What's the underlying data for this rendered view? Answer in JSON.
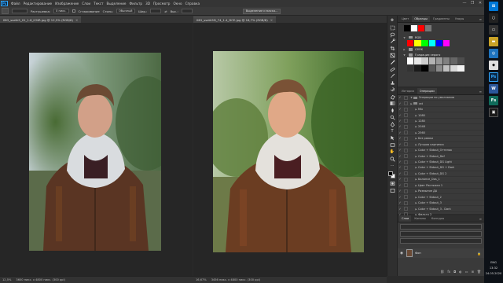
{
  "menubar": {
    "logo": "Ps",
    "items": [
      "Файл",
      "Редактирование",
      "Изображение",
      "Слои",
      "Текст",
      "Выделение",
      "Фильтр",
      "3D",
      "Просмотр",
      "Окно",
      "Справка"
    ],
    "controls": [
      "—",
      "❐",
      "✕"
    ]
  },
  "options": {
    "feather_label": "Растушевка:",
    "feather_value": "0 пикс.",
    "antialias_label": "Сглаживание",
    "style_label": "Стиль:",
    "style_value": "Обычный",
    "width_label": "Шир.:",
    "height_label": "Выс.:",
    "mask_button": "Выделение и маска..."
  },
  "tabs": {
    "doc1": "IMG_sseth5_01_1.8_ICNR.jpg @ 12,5% (RGB/8)",
    "doc2": "IMG_sseth5D_74_1.4_DCE.jpg @ 16,7% (RGB/8)",
    "close": "×"
  },
  "status": {
    "zoom1": "12,5%",
    "size1": "3600 пикс. x 4800 пикс. (300 ppi)",
    "zoom2": "16,67%",
    "size2": "3456 пикс. x 4800 пикс. (300 ppi)"
  },
  "tools": [
    "move",
    "marquee",
    "lasso",
    "quick-select",
    "crop",
    "frame",
    "eyedropper",
    "healing",
    "brush",
    "stamp",
    "history-brush",
    "eraser",
    "gradient",
    "blur",
    "dodge",
    "pen",
    "type",
    "path-select",
    "rectangle",
    "hand",
    "zoom",
    "more"
  ],
  "swatches_panel": {
    "tabs": [
      "Цвет",
      "Образцы",
      "Градиенты",
      "Узоры"
    ],
    "active_tab": "Образцы",
    "groups": [
      {
        "label": "RGB",
        "colors": [
          "#ff0000",
          "#ffff00",
          "#00ff00",
          "#00ffff",
          "#0000ff",
          "#ff00ff"
        ]
      },
      {
        "label": "CMYK",
        "colors": [
          "#00a0e9",
          "#e4007f",
          "#fff100",
          "#000000"
        ]
      },
      {
        "label": "Градации серого",
        "colors": [
          "#ffffff",
          "#e6e6e6",
          "#cccccc",
          "#b3b3b3",
          "#999999",
          "#808080",
          "#666666",
          "#4d4d4d",
          "#333333",
          "#1a1a1a",
          "#000000",
          "#595959",
          "#8c8c8c",
          "#bfbfbf",
          "#d9d9d9",
          "#f2f2f2"
        ]
      }
    ]
  },
  "actions_panel": {
    "tabs": [
      "История",
      "Операции"
    ],
    "active_tab": "Операции",
    "rows": [
      {
        "label": "Операции по умолчанию",
        "type": "folder"
      },
      {
        "label": "cat",
        "type": "folder"
      },
      {
        "label": "Mix",
        "type": "item"
      },
      {
        "label": "1080",
        "type": "item"
      },
      {
        "label": "1280",
        "type": "item"
      },
      {
        "label": "2048",
        "type": "item"
      },
      {
        "label": "2560",
        "type": "item"
      },
      {
        "label": "Без рамки",
        "type": "item"
      },
      {
        "label": "Лучшая картинка",
        "type": "item"
      },
      {
        "label": "Color + Stdout_Оттенок",
        "type": "item"
      },
      {
        "label": "Color + Stdout_Def",
        "type": "item"
      },
      {
        "label": "Color + Stdout_DG Light",
        "type": "item"
      },
      {
        "label": "Color + Stdout_DG + Dark",
        "type": "item"
      },
      {
        "label": "Color + Stdout_DG 2",
        "type": "item"
      },
      {
        "label": "Балансе_Dos_1",
        "type": "item"
      },
      {
        "label": "Цвет Растяжка 1",
        "type": "item"
      },
      {
        "label": "Размытие ДА",
        "type": "item"
      },
      {
        "label": "Color + Stdout_2",
        "type": "item"
      },
      {
        "label": "Color + Stdout_3",
        "type": "item"
      },
      {
        "label": "Color + Stdout_3 - Dark",
        "type": "item"
      },
      {
        "label": "Фильтр 2",
        "type": "item"
      }
    ]
  },
  "layers_panel": {
    "tabs": [
      "Слои",
      "Каналы",
      "Контуры"
    ],
    "active_tab": "Слои",
    "layer_name": "Фон",
    "lock": "🔒"
  },
  "taskbar": {
    "lang": "ENG",
    "time": "13:32",
    "date": "24.05.2020"
  }
}
